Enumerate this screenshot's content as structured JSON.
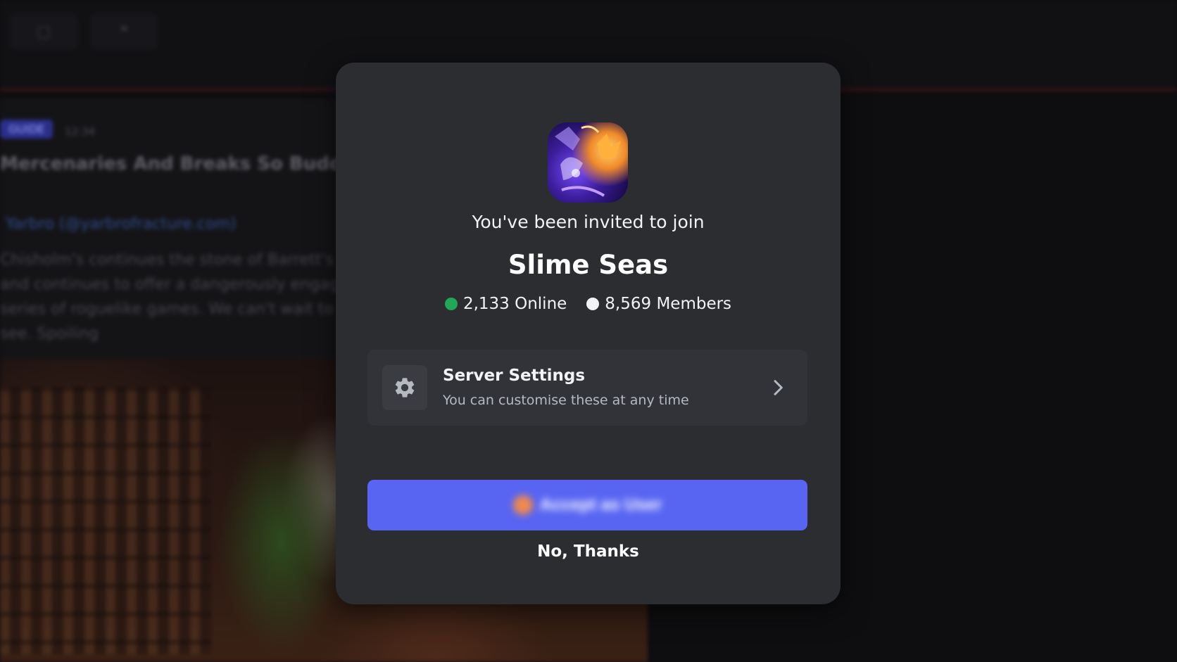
{
  "background": {
    "topbar_icons": [
      "bookmark-icon",
      "quote-icon"
    ],
    "article": {
      "tag": "GUIDE",
      "meta": "12:34",
      "headline": "Mercenaries And Breaks So Buddy",
      "link": "Yarbro (@yarbrofracture.com)",
      "paragraph": "Chisholm's continues the stone of Barrett's art and continues to offer a dangerously engaging series of roguelike games. We can't wait to see. Spoiling"
    }
  },
  "invite": {
    "subtitle": "You've been invited to join",
    "server_name": "Slime Seas",
    "online": "2,133 Online",
    "members": "8,569 Members",
    "colors": {
      "online_dot": "#23a55a",
      "members_dot": "#f2f3f5",
      "accent": "#5865f2"
    }
  },
  "settings": {
    "icon": "gear-icon",
    "title": "Server Settings",
    "subtitle": "You can customise these at any time",
    "chevron": "chevron-right-icon"
  },
  "actions": {
    "accept_label": "Accept as User",
    "decline_label": "No, Thanks"
  }
}
